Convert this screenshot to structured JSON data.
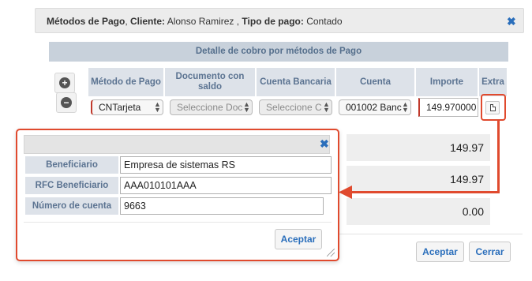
{
  "dialog": {
    "title_prefix": "Métodos de Pago",
    "cliente_label": "Cliente:",
    "cliente_value": "Alonso Ramirez",
    "tipo_label": "Tipo de pago:",
    "tipo_value": "Contado"
  },
  "section": {
    "title": "Detalle de cobro por métodos de Pago"
  },
  "table": {
    "headers": {
      "metodo": "Método de Pago",
      "documento": "Documento con saldo",
      "cuenta_bancaria": "Cuenta Bancaria",
      "cuenta": "Cuenta",
      "importe": "Importe",
      "extra": "Extra"
    },
    "row": {
      "metodo": "CNTarjeta",
      "documento": "Seleccione Doc",
      "cuenta_bancaria": "Seleccione C",
      "cuenta": "001002 Banc",
      "importe": "149.970000"
    }
  },
  "totals": [
    "149.97",
    "149.97",
    "0.00"
  ],
  "buttons": {
    "accept": "Aceptar",
    "close": "Cerrar"
  },
  "popup": {
    "fields": [
      {
        "label": "Beneficiario",
        "value": "Empresa de sistemas RS"
      },
      {
        "label": "RFC Beneficiario",
        "value": "AAA010101AAA"
      },
      {
        "label": "Número de cuenta",
        "value": "9663"
      }
    ],
    "accept": "Aceptar"
  },
  "colors": {
    "highlight": "#e04a2e",
    "accent": "#2a6ebb",
    "header_bg": "#dde2e9"
  }
}
